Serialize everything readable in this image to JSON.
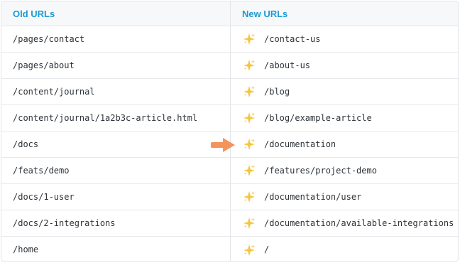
{
  "headers": {
    "old": "Old URLs",
    "new": "New URLs"
  },
  "rows": [
    {
      "old": "/pages/contact",
      "new": "/contact-us"
    },
    {
      "old": "/pages/about",
      "new": "/about-us"
    },
    {
      "old": "/content/journal",
      "new": "/blog"
    },
    {
      "old": "/content/journal/1a2b3c-article.html",
      "new": "/blog/example-article"
    },
    {
      "old": "/docs",
      "new": "/documentation",
      "highlighted": true
    },
    {
      "old": "/feats/demo",
      "new": "/features/project-demo"
    },
    {
      "old": "/docs/1-user",
      "new": "/documentation/user"
    },
    {
      "old": "/docs/2-integrations",
      "new": "/documentation/available-integrations"
    },
    {
      "old": "/home",
      "new": "/"
    }
  ],
  "icons": {
    "sparkle": "sparkles-icon",
    "pointer": "arrow-right-icon"
  },
  "colors": {
    "header_text": "#1b9ad6",
    "sparkle": "#f5c542",
    "arrow": "#f4935a"
  }
}
